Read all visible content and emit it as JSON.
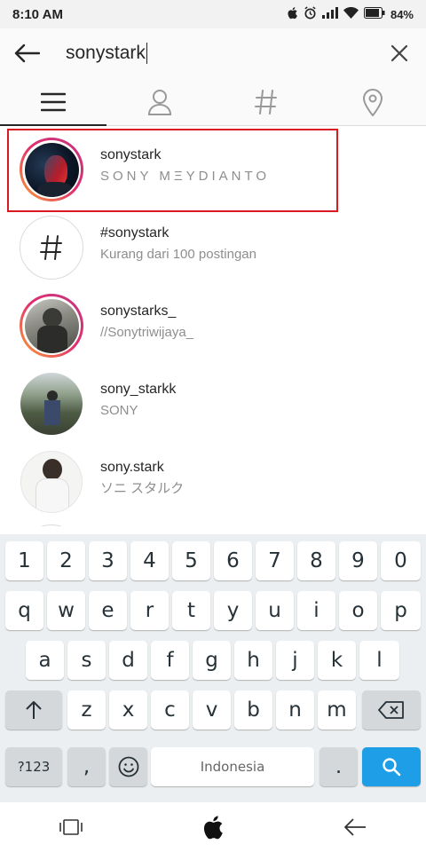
{
  "status": {
    "time": "8:10 AM",
    "battery": "84%"
  },
  "search": {
    "query": "sonystark"
  },
  "tabs": [
    {
      "name": "top",
      "icon": "list-icon",
      "active": true
    },
    {
      "name": "people",
      "icon": "person-icon",
      "active": false
    },
    {
      "name": "tags",
      "icon": "hashtag-icon",
      "active": false
    },
    {
      "name": "places",
      "icon": "location-pin-icon",
      "active": false
    }
  ],
  "results": [
    {
      "title": "sonystark",
      "subtitle": "SONY MΞYDIANTO",
      "kind": "account",
      "highlighted": true
    },
    {
      "title": "#sonystark",
      "subtitle": "Kurang dari 100 postingan",
      "kind": "hashtag"
    },
    {
      "title": "sonystarks_",
      "subtitle": "//Sonytriwijaya_",
      "kind": "account"
    },
    {
      "title": "sony_starkk",
      "subtitle": "SONY",
      "kind": "account"
    },
    {
      "title": "sony.stark",
      "subtitle": "ソニ スタルク",
      "kind": "account"
    }
  ],
  "keyboard": {
    "numbers": [
      "1",
      "2",
      "3",
      "4",
      "5",
      "6",
      "7",
      "8",
      "9",
      "0"
    ],
    "row1": [
      "q",
      "w",
      "e",
      "r",
      "t",
      "y",
      "u",
      "i",
      "o",
      "p"
    ],
    "row2": [
      "a",
      "s",
      "d",
      "f",
      "g",
      "h",
      "j",
      "k",
      "l"
    ],
    "row3": [
      "z",
      "x",
      "c",
      "v",
      "b",
      "n",
      "m"
    ],
    "symbols_label": "?123",
    "comma": ",",
    "space_label": "Indonesia",
    "period": ".",
    "accent": "#1e9ee6"
  },
  "navbar": {
    "icons": [
      "recents-icon",
      "home-apple-icon",
      "back-icon"
    ]
  }
}
